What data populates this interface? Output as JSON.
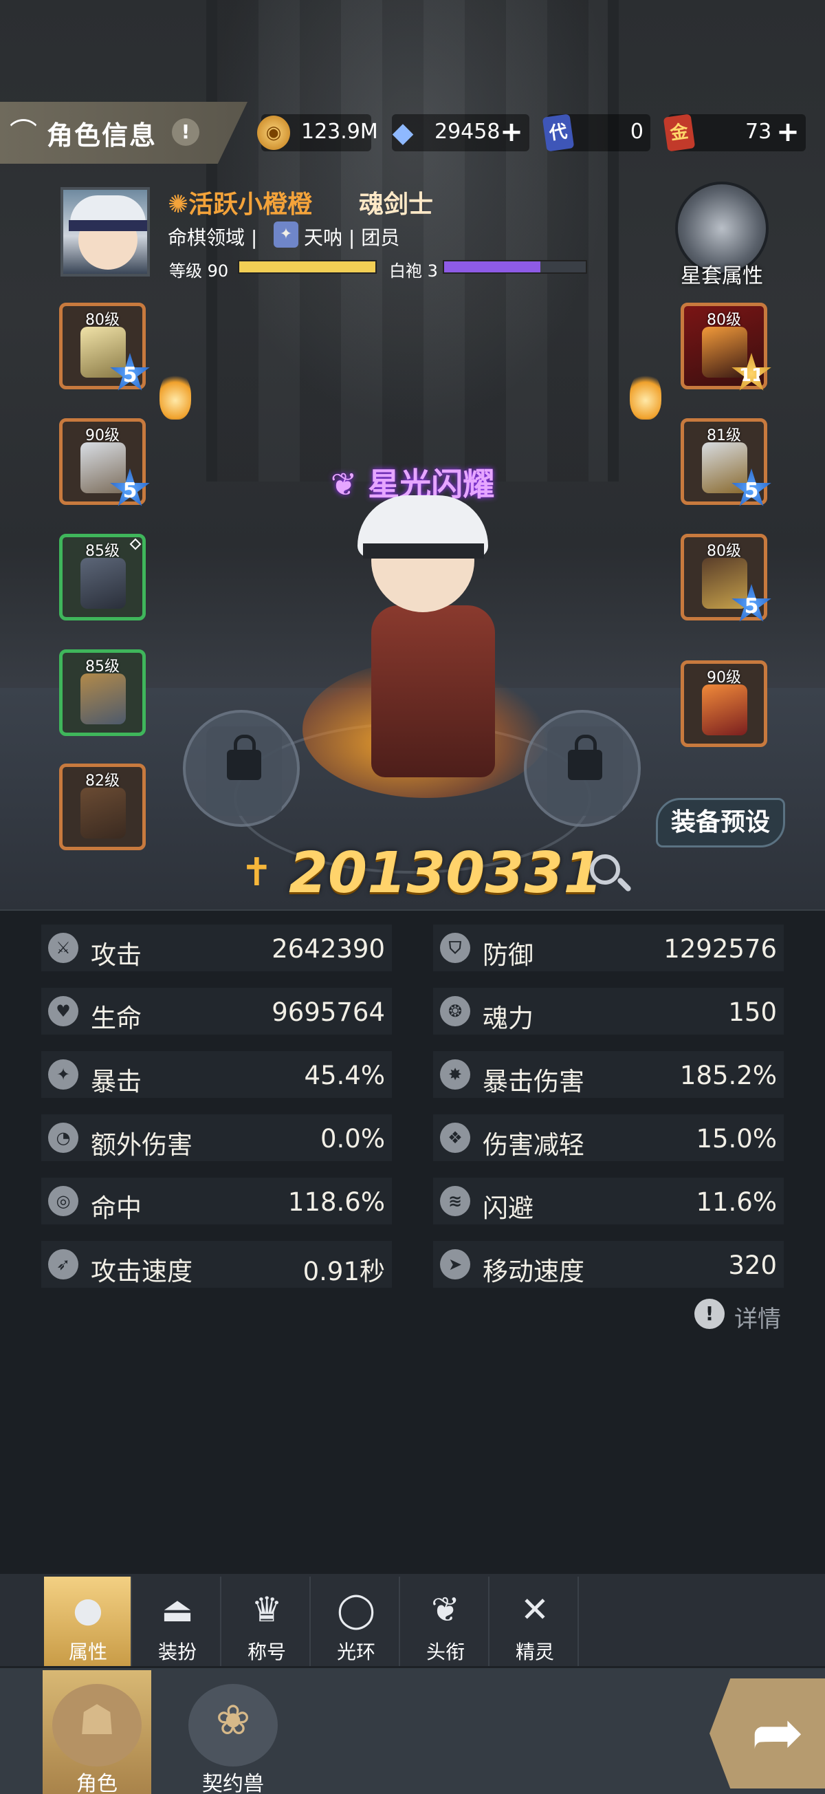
{
  "header": {
    "title": "角色信息",
    "help_icon": "!",
    "resources": [
      {
        "name": "gold-coin",
        "value": "123.9M",
        "has_plus": false
      },
      {
        "name": "crystal",
        "value": "29458",
        "has_plus": true
      },
      {
        "name": "card-代",
        "glyph": "代",
        "value": "0",
        "has_plus": false
      },
      {
        "name": "card-金",
        "glyph": "金",
        "value": "73",
        "has_plus": true
      }
    ]
  },
  "player": {
    "name": "活跃小橙橙",
    "class": "魂剑士",
    "guild_line": "命棋领域",
    "guild_name": "天呐",
    "guild_role": "团员",
    "level_label": "等级 90",
    "level_fill": 1.0,
    "robe_label": "白袍 3",
    "robe_fill": 0.68,
    "star_set_label": "星套属性",
    "title": "星光闪耀"
  },
  "equipment_left": [
    {
      "level": "80级",
      "border": "orange",
      "stars": "5"
    },
    {
      "level": "90级",
      "border": "orange",
      "stars": "5"
    },
    {
      "level": "85级",
      "border": "green",
      "stars": ""
    },
    {
      "level": "85级",
      "border": "green",
      "stars": ""
    },
    {
      "level": "82级",
      "border": "orange",
      "stars": ""
    }
  ],
  "equipment_right": [
    {
      "level": "80级",
      "border": "red",
      "stars": "11"
    },
    {
      "level": "81级",
      "border": "orange",
      "stars": "5"
    },
    {
      "level": "80级",
      "border": "orange",
      "stars": "5"
    },
    {
      "level": "90级",
      "border": "orange",
      "stars": ""
    }
  ],
  "preset_button": "装备预设",
  "combat_power": "20130331",
  "stats": [
    {
      "label": "攻击",
      "value": "2642390",
      "icon": "sword"
    },
    {
      "label": "防御",
      "value": "1292576",
      "icon": "shield"
    },
    {
      "label": "生命",
      "value": "9695764",
      "icon": "heart"
    },
    {
      "label": "魂力",
      "value": "150",
      "icon": "soul"
    },
    {
      "label": "暴击",
      "value": "45.4%",
      "icon": "crit"
    },
    {
      "label": "暴击伤害",
      "value": "185.2%",
      "icon": "crit-damage"
    },
    {
      "label": "额外伤害",
      "value": "0.0%",
      "icon": "extra-damage"
    },
    {
      "label": "伤害减轻",
      "value": "15.0%",
      "icon": "damage-reduction"
    },
    {
      "label": "命中",
      "value": "118.6%",
      "icon": "target"
    },
    {
      "label": "闪避",
      "value": "11.6%",
      "icon": "dodge"
    },
    {
      "label": "攻击速度",
      "value": "0.91秒",
      "icon": "attack-speed"
    },
    {
      "label": "移动速度",
      "value": "320",
      "icon": "move-speed"
    }
  ],
  "details_label": "详情",
  "subtabs": [
    {
      "label": "属性",
      "icon": "person",
      "active": true
    },
    {
      "label": "装扮",
      "icon": "hanger",
      "active": false
    },
    {
      "label": "称号",
      "icon": "crown",
      "active": false
    },
    {
      "label": "光环",
      "icon": "halo",
      "active": false
    },
    {
      "label": "头衔",
      "icon": "emblem",
      "active": false
    },
    {
      "label": "精灵",
      "icon": "sprite",
      "active": false
    }
  ],
  "maintabs": [
    {
      "label": "角色",
      "active": true
    },
    {
      "label": "契约兽",
      "active": false
    }
  ]
}
